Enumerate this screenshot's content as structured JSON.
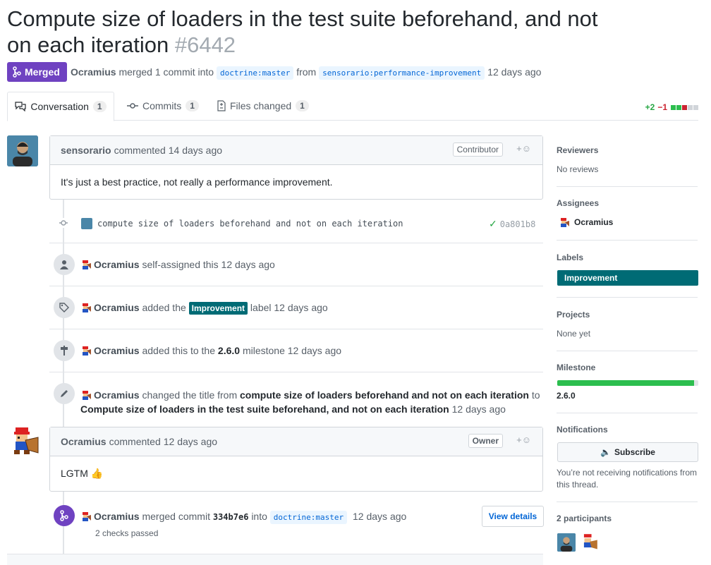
{
  "title": {
    "text": "Compute size of loaders in the test suite beforehand, and not on each iteration",
    "number": "#6442"
  },
  "state_badge": "Merged",
  "meta": {
    "author": "Ocramius",
    "action": "merged 1 commit into",
    "base": "doctrine:master",
    "from_text": "from",
    "head": "sensorario:performance-improvement",
    "time": "12 days ago"
  },
  "tabs": [
    {
      "label": "Conversation",
      "count": "1"
    },
    {
      "label": "Commits",
      "count": "1"
    },
    {
      "label": "Files changed",
      "count": "1"
    }
  ],
  "diffstat": {
    "add": "+2",
    "del": "−1"
  },
  "comment1": {
    "author": "sensorario",
    "action": "commented",
    "time": "14 days ago",
    "role": "Contributor",
    "body": "It's just a best practice, not really a performance improvement."
  },
  "commit": {
    "message": "compute size of loaders beforehand and not on each iteration",
    "sha": "0a801b8"
  },
  "events": {
    "assign": {
      "actor": "Ocramius",
      "text": "self-assigned this 12 days ago"
    },
    "label": {
      "actor": "Ocramius",
      "pre": "added the",
      "label": "Improvement",
      "post": "label 12 days ago"
    },
    "milestone": {
      "actor": "Ocramius",
      "pre": "added this to the",
      "milestone": "2.6.0",
      "post": "milestone 12 days ago"
    },
    "rename": {
      "actor": "Ocramius",
      "pre": "changed the title from",
      "old": "compute size of loaders beforehand and not on each iteration",
      "to": "to",
      "new": "Compute size of loaders in the test suite beforehand, and not on each iteration",
      "time": "12 days ago"
    }
  },
  "comment2": {
    "author": "Ocramius",
    "action": "commented",
    "time": "12 days ago",
    "role": "Owner",
    "body": "LGTM 👍"
  },
  "merge_event": {
    "actor": "Ocramius",
    "pre": "merged commit",
    "sha": "334b7e6",
    "into": "into",
    "base": "doctrine:master",
    "time": "12 days ago",
    "checks": "2 checks passed",
    "button": "View details"
  },
  "sidebar": {
    "reviewers": {
      "heading": "Reviewers",
      "value": "No reviews"
    },
    "assignees": {
      "heading": "Assignees",
      "value": "Ocramius"
    },
    "labels": {
      "heading": "Labels",
      "value": "Improvement",
      "color": "#006b75"
    },
    "projects": {
      "heading": "Projects",
      "value": "None yet"
    },
    "milestone": {
      "heading": "Milestone",
      "value": "2.6.0",
      "progress": 0.97
    },
    "notifications": {
      "heading": "Notifications",
      "button": "Subscribe",
      "note": "You’re not receiving notifications from this thread."
    },
    "participants": {
      "heading": "2 participants"
    }
  },
  "colors": {
    "merged": "#6f42c1",
    "label": "#006b75",
    "progress": "#2cbe4e"
  }
}
